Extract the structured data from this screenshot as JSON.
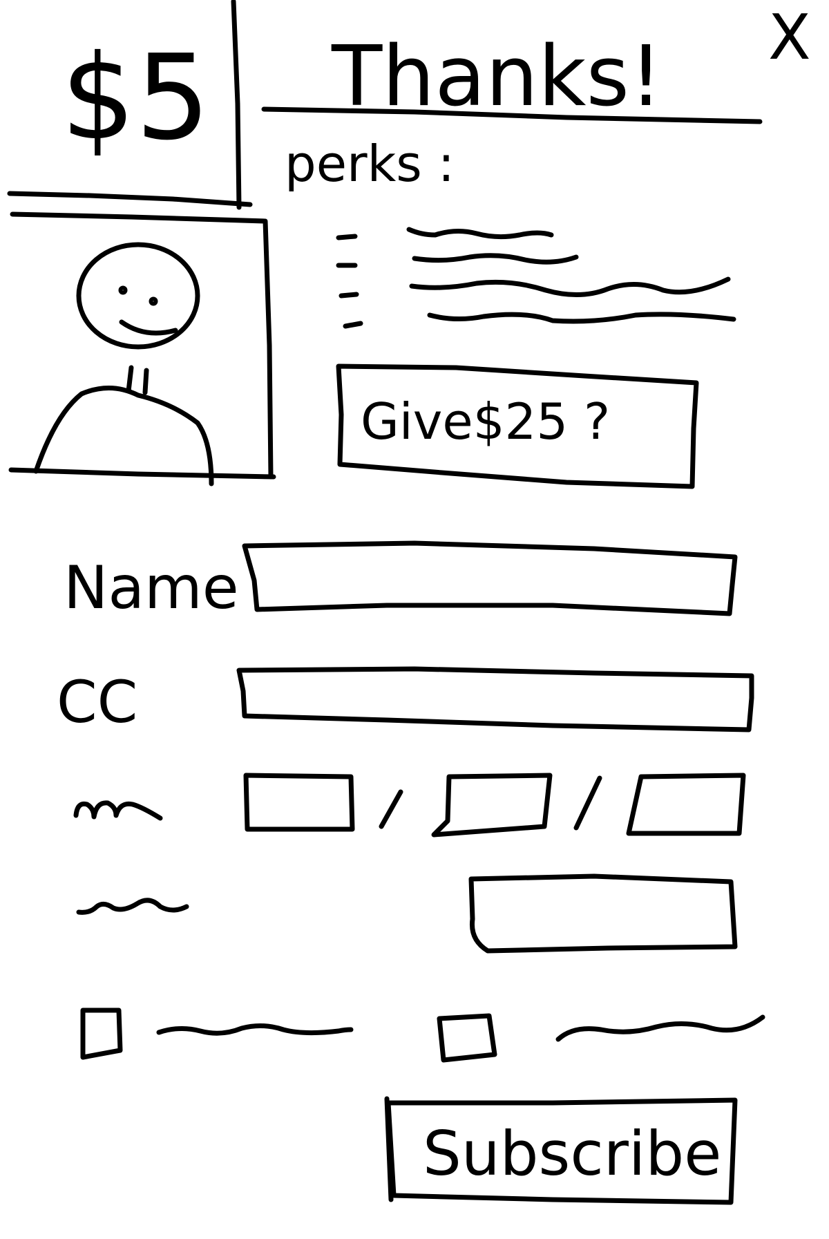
{
  "header": {
    "amount": "$5",
    "title": "Thanks!",
    "close": "X"
  },
  "perks": {
    "label": "perks :",
    "count": 4
  },
  "upsell": {
    "button_label": "Give$25 ?"
  },
  "form": {
    "name_label": "Name",
    "cc_label": "CC",
    "date_separator": "/"
  },
  "actions": {
    "subscribe_label": "Subscribe"
  },
  "colors": {
    "ink": "#000000",
    "paper": "#ffffff"
  }
}
